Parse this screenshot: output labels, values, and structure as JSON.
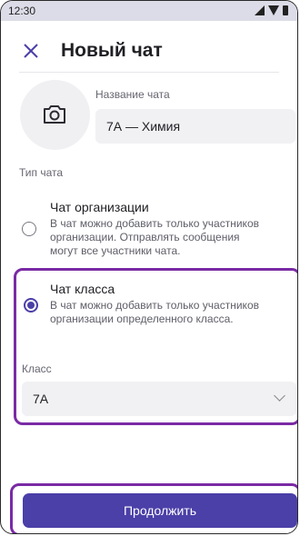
{
  "status_bar": {
    "time": "12:30"
  },
  "header": {
    "title": "Новый чат"
  },
  "chat_name": {
    "label": "Название чата",
    "value": "7А — Химия"
  },
  "chat_type": {
    "label": "Тип чата",
    "options": [
      {
        "title": "Чат организации",
        "description": [
          "В чат можно добавить только участников",
          "организации. Отправлять сообщения",
          "могут все участники чата."
        ],
        "selected": false
      },
      {
        "title": "Чат класса",
        "description": [
          "В чат можно добавить только участников",
          "организации определенного класса."
        ],
        "selected": true
      }
    ]
  },
  "class_select": {
    "label": "Класс",
    "value": "7А"
  },
  "cta": {
    "label": "Продолжить"
  },
  "colors": {
    "accent": "#4b3fa8",
    "highlight": "#7a2aa5"
  }
}
